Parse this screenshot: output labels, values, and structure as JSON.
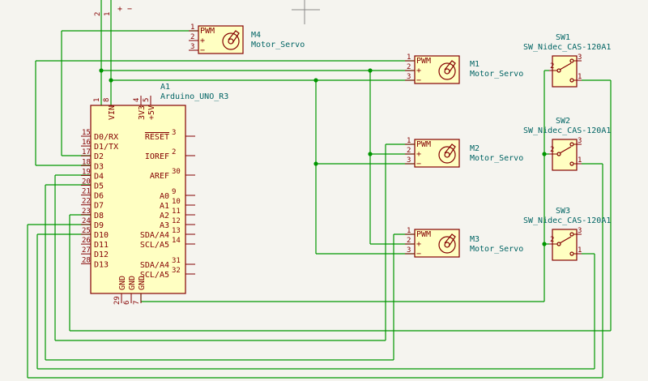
{
  "power": {
    "pin2": "2",
    "pin1": "1",
    "plus": "+",
    "minus": "−"
  },
  "servos": [
    {
      "ref": "M4",
      "value": "Motor_Servo",
      "pwm": "PWM",
      "plus": "+",
      "minus": "−",
      "p1": "1",
      "p2": "2",
      "p3": "3"
    },
    {
      "ref": "M1",
      "value": "Motor_Servo",
      "pwm": "PWM",
      "plus": "+",
      "minus": "−",
      "p1": "1",
      "p2": "2",
      "p3": "3"
    },
    {
      "ref": "M2",
      "value": "Motor_Servo",
      "pwm": "PWM",
      "plus": "+",
      "minus": "−",
      "p1": "1",
      "p2": "2",
      "p3": "3"
    },
    {
      "ref": "M3",
      "value": "Motor_Servo",
      "pwm": "PWM",
      "plus": "+",
      "minus": "−",
      "p1": "1",
      "p2": "2",
      "p3": "3"
    }
  ],
  "switches": [
    {
      "ref": "SW1",
      "value": "SW_Nidec_CAS-120A1",
      "p1": "1",
      "p2": "2",
      "p3": "3"
    },
    {
      "ref": "SW2",
      "value": "SW_Nidec_CAS-120A1",
      "p1": "1",
      "p2": "2",
      "p3": "3"
    },
    {
      "ref": "SW3",
      "value": "SW_Nidec_CAS-120A1",
      "p1": "1",
      "p2": "2",
      "p3": "3"
    }
  ],
  "arduino": {
    "ref": "A1",
    "value": "Arduino_UNO_R3",
    "left_pins": [
      {
        "num": "15",
        "name": "D0/RX"
      },
      {
        "num": "16",
        "name": "D1/TX"
      },
      {
        "num": "17",
        "name": "D2"
      },
      {
        "num": "18",
        "name": "D3"
      },
      {
        "num": "19",
        "name": "D4"
      },
      {
        "num": "20",
        "name": "D5"
      },
      {
        "num": "21",
        "name": "D6"
      },
      {
        "num": "22",
        "name": "D7"
      },
      {
        "num": "23",
        "name": "D8"
      },
      {
        "num": "24",
        "name": "D9"
      },
      {
        "num": "25",
        "name": "D10"
      },
      {
        "num": "26",
        "name": "D11"
      },
      {
        "num": "27",
        "name": "D12"
      },
      {
        "num": "28",
        "name": "D13"
      }
    ],
    "right_pins": [
      {
        "num": "3",
        "name": "RESET"
      },
      {
        "num": "2",
        "name": "IOREF"
      },
      {
        "num": "30",
        "name": "AREF"
      },
      {
        "num": "9",
        "name": "A0"
      },
      {
        "num": "10",
        "name": "A1"
      },
      {
        "num": "11",
        "name": "A2"
      },
      {
        "num": "12",
        "name": "A3"
      },
      {
        "num": "13",
        "name": "SDA/A4"
      },
      {
        "num": "14",
        "name": "SCL/A5"
      },
      {
        "num": "31",
        "name": "SDA/A4"
      },
      {
        "num": "32",
        "name": "SCL/A5"
      }
    ],
    "top_pins": [
      {
        "num": "1",
        "name": ""
      },
      {
        "num": "8",
        "name": "VIN"
      },
      {
        "num": "4",
        "name": "3V3"
      },
      {
        "num": "5",
        "name": "+5V"
      }
    ],
    "bottom_pins": [
      {
        "num": "29",
        "name": "GND"
      },
      {
        "num": "6",
        "name": "GND"
      },
      {
        "num": "7",
        "name": "GND"
      }
    ]
  }
}
